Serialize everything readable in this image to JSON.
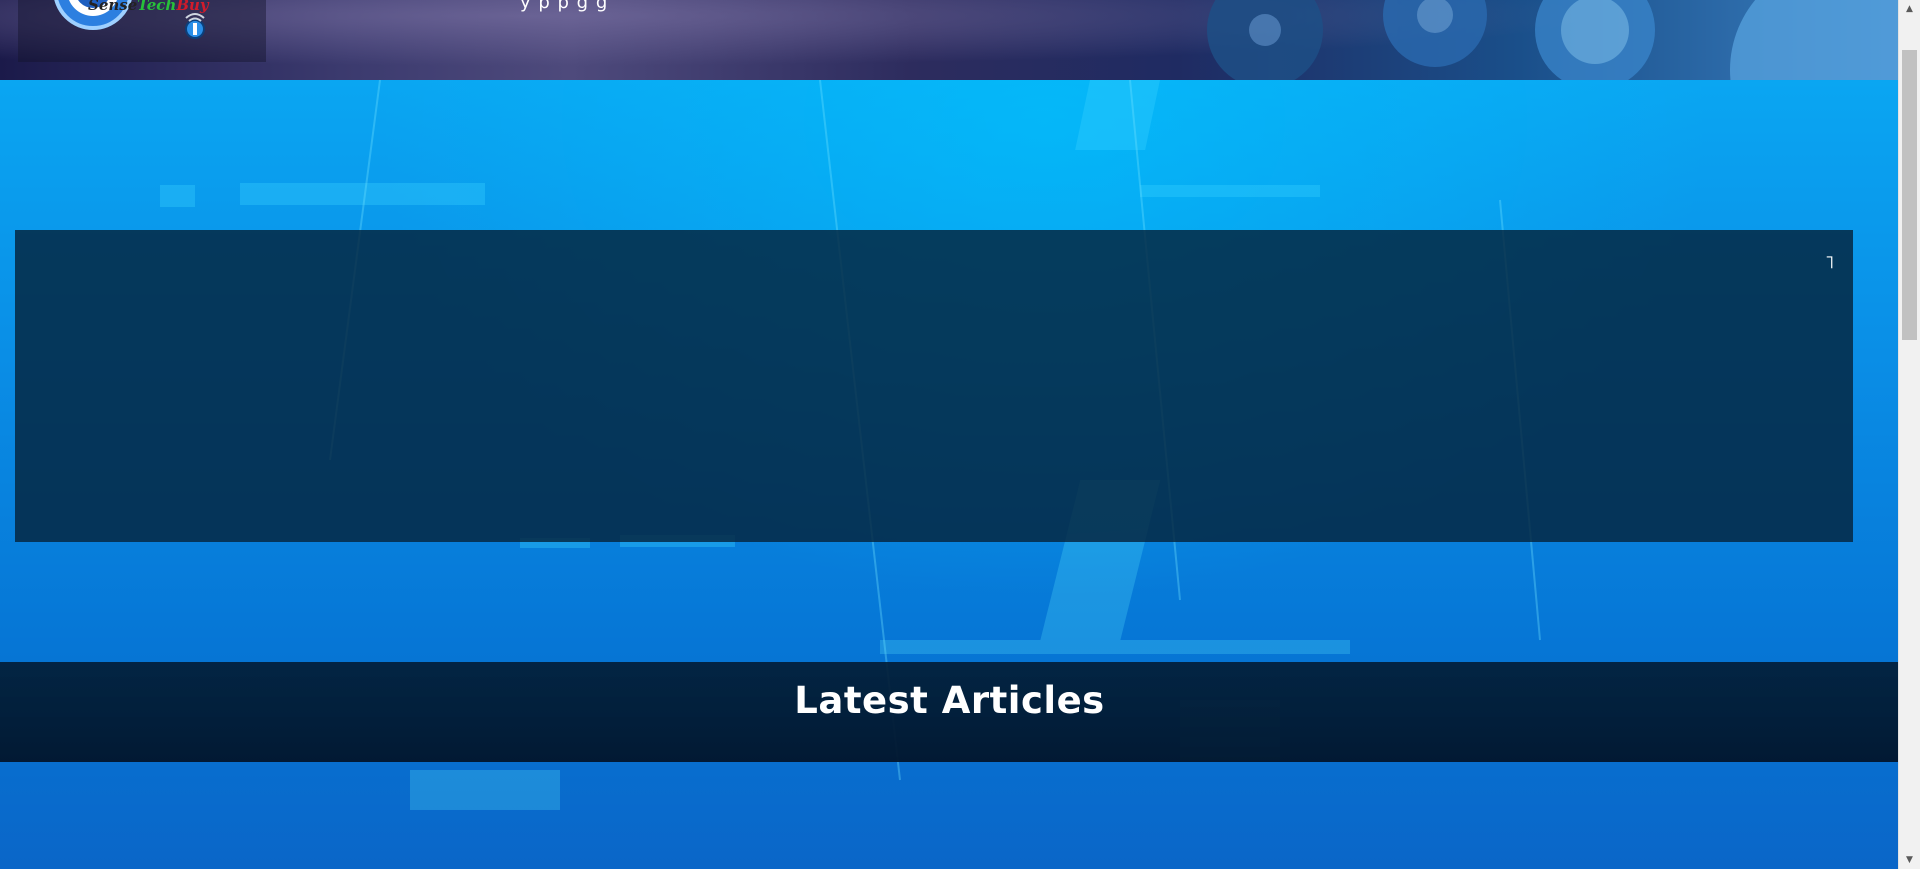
{
  "header": {
    "logo_text_a": "Sense",
    "logo_text_b": "Tech",
    "logo_text_c": "Buy",
    "nav_strip": "y    p          p       g                    g"
  },
  "hero": {
    "panel_glyph": "˥"
  },
  "latest": {
    "title": "Latest Articles"
  },
  "colors": {
    "hero_blue": "#0a8ee6",
    "panel_dark": "#05233c",
    "band_dark": "#021a32",
    "title_text": "#ffffff"
  },
  "icons": {
    "logo": "site-logo-icon",
    "badge": "wifi-badge-icon",
    "gears": "gears-icon"
  }
}
